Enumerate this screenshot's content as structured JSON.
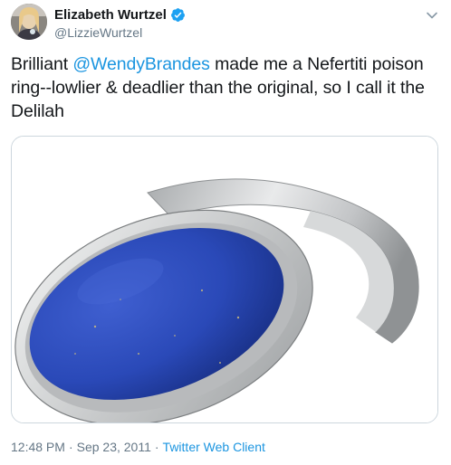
{
  "author": {
    "display_name": "Elizabeth Wurtzel",
    "handle": "@LizzieWurtzel",
    "verified_icon": "verified-badge-icon",
    "avatar_icon": "profile-avatar"
  },
  "tweet": {
    "text_before": "Brilliant ",
    "mention": "@WendyBrandes",
    "text_after": " made me a Nefertiti poison ring--lowlier & deadlier than the original, so I call it the Delilah"
  },
  "media": {
    "image_icon": "lapis-silver-ring-image"
  },
  "meta": {
    "time": "12:48 PM",
    "separator": "·",
    "date": "Sep 23, 2011",
    "separator2": "·",
    "source": "Twitter Web Client"
  },
  "colors": {
    "link": "#1b95e0",
    "secondary_text": "#657786",
    "verified": "#1da1f2",
    "lapis": "#2a49b8"
  }
}
